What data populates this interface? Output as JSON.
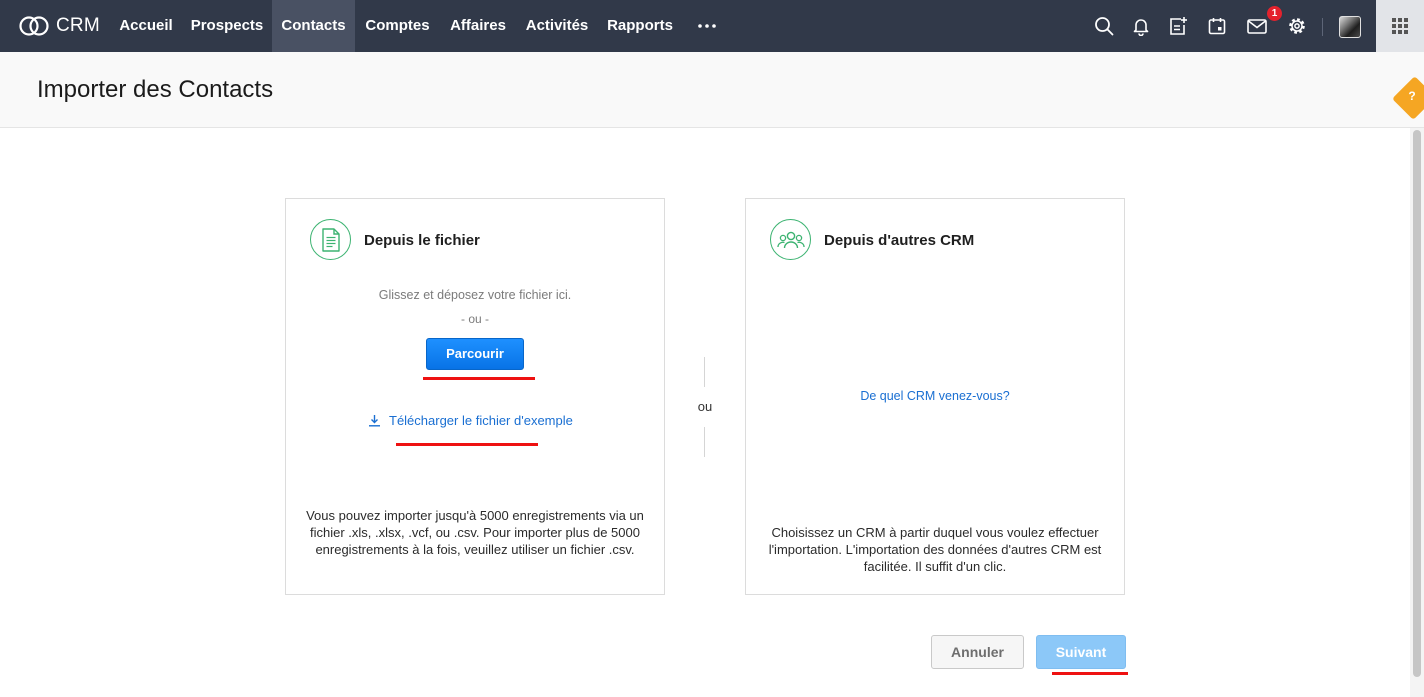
{
  "app": {
    "name": "CRM"
  },
  "nav": {
    "items": [
      {
        "label": "Accueil"
      },
      {
        "label": "Prospects"
      },
      {
        "label": "Contacts",
        "active": true
      },
      {
        "label": "Comptes"
      },
      {
        "label": "Affaires"
      },
      {
        "label": "Activités"
      },
      {
        "label": "Rapports"
      }
    ],
    "more_icon": "ellipsis-icon",
    "tools": [
      "search-icon",
      "bell-icon",
      "add-note-icon",
      "calendar-icon",
      "mail-icon",
      "gear-icon"
    ],
    "mail_badge": "1",
    "apps_icon": "grid-icon"
  },
  "page": {
    "title": "Importer des Contacts"
  },
  "from_file": {
    "title": "Depuis le fichier",
    "icon": "document-icon",
    "drop_hint": "Glissez et déposez votre fichier ici.",
    "or_label": "- ou -",
    "browse_label": "Parcourir",
    "download_label": "Télécharger le fichier d'exemple",
    "note": "Vous pouvez importer jusqu'à 5000 enregistrements via un fichier .xls, .xlsx, .vcf, ou .csv. Pour importer plus de 5000 enregistrements à la fois, veuillez utiliser un fichier .csv."
  },
  "separator": {
    "label": "ou"
  },
  "from_crm": {
    "title": "Depuis d'autres CRM",
    "icon": "users-icon",
    "link_label": "De quel CRM venez-vous?",
    "note": "Choisissez un CRM à partir duquel vous voulez effectuer l'importation. L'importation des données d'autres CRM est facilitée. Il suffit d'un clic."
  },
  "actions": {
    "cancel_label": "Annuler",
    "next_label": "Suivant"
  },
  "help": {
    "label": "?"
  },
  "colors": {
    "nav_bg": "#313949",
    "nav_active": "#495163",
    "primary": "#0873e6",
    "accent_green": "#3cb371",
    "link": "#1a6fd2",
    "annotation": "#e11111",
    "help": "#f5a623"
  }
}
